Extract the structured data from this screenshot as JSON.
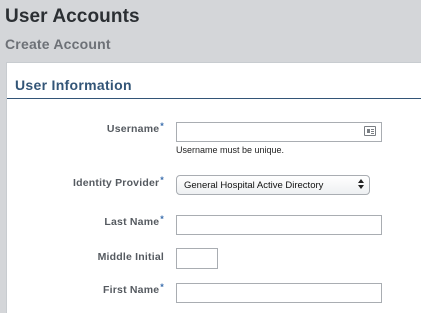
{
  "header": {
    "title": "User Accounts",
    "subtitle": "Create Account"
  },
  "section": {
    "title": "User Information"
  },
  "fields": {
    "username": {
      "label": "Username",
      "required_mark": "*",
      "value": "",
      "hint": "Username must be unique.",
      "icon": "contact-card-icon"
    },
    "identity_provider": {
      "label": "Identity Provider",
      "required_mark": "*",
      "selected": "General Hospital Active Directory"
    },
    "last_name": {
      "label": "Last Name",
      "required_mark": "*",
      "value": ""
    },
    "middle_initial": {
      "label": "Middle Initial",
      "value": ""
    },
    "first_name": {
      "label": "First Name",
      "required_mark": "*",
      "value": ""
    }
  },
  "colors": {
    "section_title": "#335577",
    "required": "#3c6fae",
    "page_background": "#d4d6d9"
  }
}
